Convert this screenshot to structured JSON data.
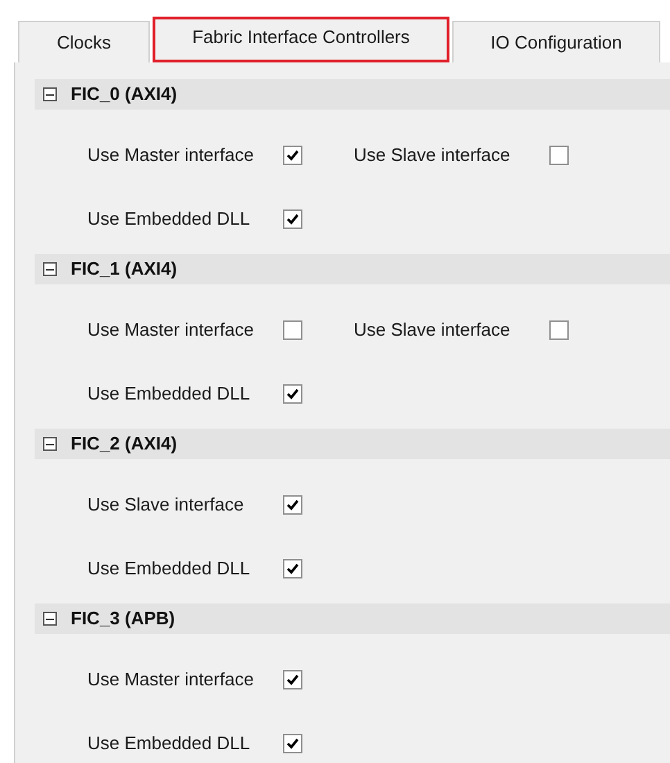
{
  "tabs": [
    {
      "label": "Clocks",
      "selected": false
    },
    {
      "label": "Fabric Interface Controllers",
      "selected": true
    },
    {
      "label": "IO Configuration",
      "selected": false
    }
  ],
  "sections": [
    {
      "title": "FIC_0 (AXI4)",
      "expanded": true,
      "rows": [
        [
          {
            "label": "Use Master interface",
            "checked": true
          },
          {
            "label": "Use Slave interface",
            "checked": false
          }
        ],
        [
          {
            "label": "Use Embedded DLL",
            "checked": true
          }
        ]
      ]
    },
    {
      "title": "FIC_1 (AXI4)",
      "expanded": true,
      "rows": [
        [
          {
            "label": "Use Master interface",
            "checked": false
          },
          {
            "label": "Use Slave interface",
            "checked": false
          }
        ],
        [
          {
            "label": "Use Embedded DLL",
            "checked": true
          }
        ]
      ]
    },
    {
      "title": "FIC_2 (AXI4)",
      "expanded": true,
      "rows": [
        [
          {
            "label": "Use Slave interface",
            "checked": true
          }
        ],
        [
          {
            "label": "Use Embedded DLL",
            "checked": true
          }
        ]
      ]
    },
    {
      "title": "FIC_3 (APB)",
      "expanded": true,
      "rows": [
        [
          {
            "label": "Use Master interface",
            "checked": true
          }
        ],
        [
          {
            "label": "Use Embedded DLL",
            "checked": true
          }
        ]
      ]
    }
  ]
}
